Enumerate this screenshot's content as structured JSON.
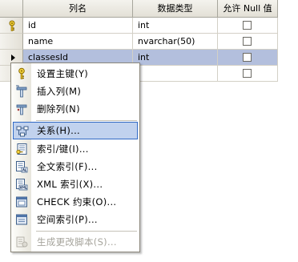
{
  "grid": {
    "headers": [
      "列名",
      "数据类型",
      "允许 Null 值"
    ],
    "rows": [
      {
        "name": "id",
        "type": "int",
        "nullable": false,
        "marker": "key"
      },
      {
        "name": "name",
        "type": "nvarchar(50)",
        "nullable": false,
        "marker": ""
      },
      {
        "name": "classesId",
        "type": "int",
        "nullable": false,
        "marker": "current"
      },
      {
        "name": "",
        "type": "",
        "nullable": false,
        "marker": ""
      }
    ]
  },
  "menu": {
    "items": [
      {
        "label": "设置主键(Y)",
        "icon": "key-icon"
      },
      {
        "label": "插入列(M)",
        "icon": "insert-column-icon"
      },
      {
        "label": "删除列(N)",
        "icon": "delete-column-icon"
      },
      {
        "label": "关系(H)...",
        "icon": "relationship-icon"
      },
      {
        "label": "索引/键(I)...",
        "icon": "index-key-icon"
      },
      {
        "label": "全文索引(F)...",
        "icon": "fulltext-index-icon"
      },
      {
        "label": "XML 索引(X)...",
        "icon": "xml-index-icon"
      },
      {
        "label": "CHECK 约束(O)...",
        "icon": "check-constraint-icon"
      },
      {
        "label": "空间索引(P)...",
        "icon": "spatial-index-icon"
      },
      {
        "label": "生成更改脚本(S)...",
        "icon": "generate-script-icon"
      }
    ]
  },
  "colors": {
    "selected_row": "#b3bfdd",
    "menu_highlight": "#c1d2ee",
    "menu_highlight_border": "#316ac5"
  }
}
